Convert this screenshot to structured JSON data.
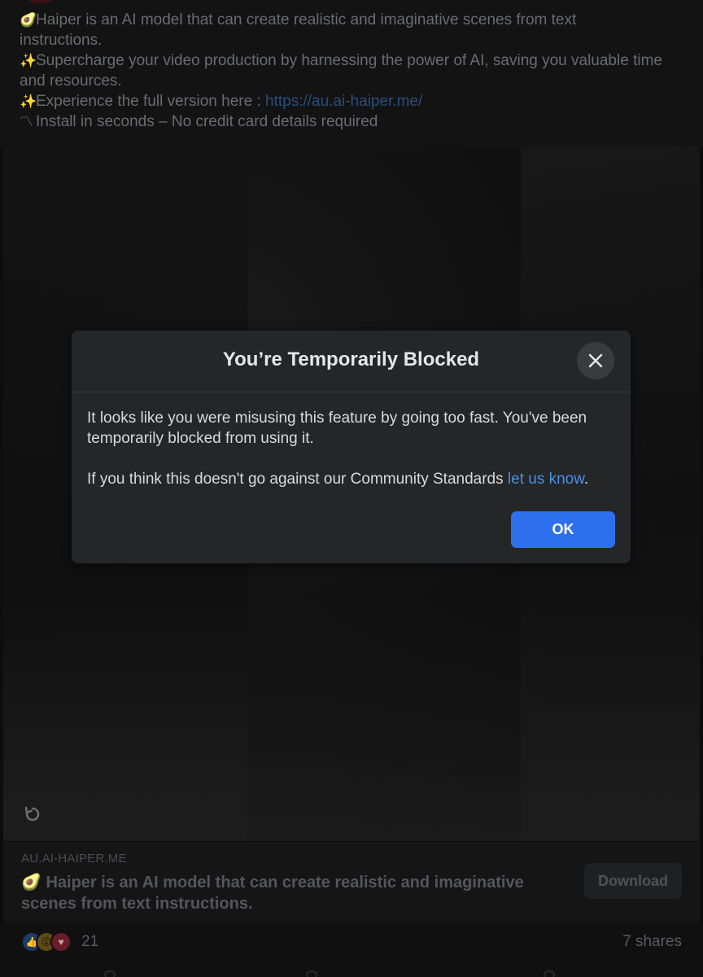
{
  "post": {
    "lines": [
      {
        "emoji": "🥑",
        "text": "Haiper is an AI model that can create realistic and imaginative scenes from text"
      },
      {
        "emoji": "",
        "text": "instructions."
      },
      {
        "emoji": "✨",
        "text": "Supercharge your video production by harnessing the power of AI, saving you valuable time"
      },
      {
        "emoji": "",
        "text": "and resources."
      },
      {
        "emoji": "✨",
        "text": "Experience the full version here : ",
        "link": "https://au.ai-haiper.me/"
      },
      {
        "emoji": "〽",
        "text": "Install in seconds – No credit card details required"
      }
    ]
  },
  "media": {
    "replay_icon": "replay-icon"
  },
  "link_card": {
    "domain": "AU.AI-HAIPER.ME",
    "title_emoji": "🥑",
    "title": "Haiper is an AI model that can create realistic and imaginative scenes from text instructions.",
    "download_label": "Download"
  },
  "footer": {
    "reaction_count": "21",
    "shares": "7 shares"
  },
  "modal": {
    "title": "You’re Temporarily Blocked",
    "body_1": "It looks like you were misusing this feature by going too fast. You've been temporarily blocked from using it.",
    "body_2_prefix": "If you think this doesn't go against our Community Standards ",
    "body_2_link": "let us know",
    "body_2_suffix": ".",
    "ok_label": "OK",
    "close_icon": "close-icon"
  },
  "colors": {
    "accent": "#2e6fee",
    "link": "#4a8fe8",
    "modal_bg": "#252628"
  }
}
